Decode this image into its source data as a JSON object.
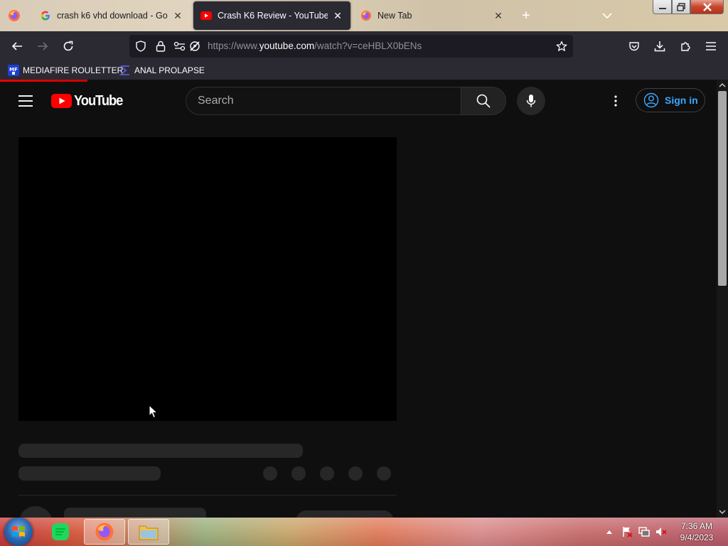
{
  "browser": {
    "tabs": [
      {
        "title": "crash k6 vhd download - Google Search",
        "favicon": "google-g-icon",
        "active": false
      },
      {
        "title": "Crash K6 Review - YouTube",
        "favicon": "youtube-icon",
        "active": true
      },
      {
        "title": "New Tab",
        "favicon": "firefox-icon",
        "active": false
      }
    ],
    "close_glyph": "✕",
    "new_tab_glyph": "+",
    "url": {
      "prefix": "https://www.",
      "domain": "youtube.com",
      "path": "/watch?v=ceHBLX0bENs"
    },
    "bookmarks": [
      {
        "label": "MEDIAFIRE ROULETTER",
        "icon": "mediafire-icon",
        "icon_text": "MF"
      },
      {
        "label": "ANAL PROLAPSE",
        "icon": "sigma-icon"
      }
    ],
    "load_progress": 0.12
  },
  "youtube": {
    "logo_text": "YouTube",
    "search_placeholder": "Search",
    "sign_in_label": "Sign in",
    "colors": {
      "brand_red": "#ff0000",
      "link_blue": "#3ea6ff"
    }
  },
  "taskbar": {
    "apps": [
      {
        "name": "spotify",
        "open": false
      },
      {
        "name": "firefox",
        "open": true
      },
      {
        "name": "file-explorer",
        "open": true
      }
    ],
    "time": "7:36 AM",
    "date": "9/4/2023"
  }
}
